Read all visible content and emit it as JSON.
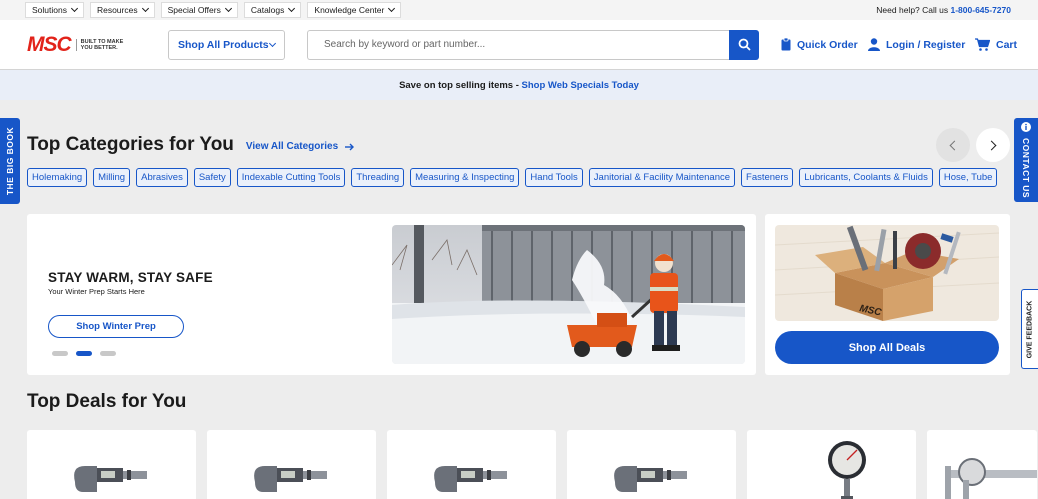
{
  "utility": {
    "menus": [
      "Solutions",
      "Resources",
      "Special Offers",
      "Catalogs",
      "Knowledge Center"
    ],
    "help_text": "Need help? Call us",
    "phone": "1-800-645-7270"
  },
  "header": {
    "logo_text": "MSC",
    "logo_tagline": "BUILT TO MAKE YOU BETTER.",
    "shop_all_label": "Shop All Products",
    "search_placeholder": "Search by keyword or part number...",
    "quick_order": "Quick Order",
    "login": "Login / Register",
    "cart": "Cart"
  },
  "promo": {
    "text": "Save on top selling items - ",
    "link": "Shop Web Specials Today"
  },
  "categories": {
    "title": "Top Categories for You",
    "view_all": "View All Categories",
    "items": [
      "Holemaking",
      "Milling",
      "Abrasives",
      "Safety",
      "Indexable Cutting Tools",
      "Threading",
      "Measuring & Inspecting",
      "Hand Tools",
      "Janitorial & Facility Maintenance",
      "Fasteners",
      "Lubricants, Coolants & Fluids",
      "Hose, Tube"
    ]
  },
  "hero": {
    "title": "STAY WARM, STAY SAFE",
    "subtitle": "Your Winter Prep Starts Here",
    "button": "Shop Winter Prep",
    "slide_count": 3,
    "active_slide": 2
  },
  "deals_card": {
    "box_label": "MSC",
    "button": "Shop All Deals"
  },
  "deals": {
    "title": "Top Deals for You"
  },
  "side_tabs": {
    "big_book": "THE BIG BOOK",
    "contact": "CONTACT US",
    "feedback": "GIVE FEEDBACK"
  },
  "colors": {
    "brand_blue": "#1756c8",
    "logo_red": "#e2231a",
    "page_bg": "#ededed"
  }
}
